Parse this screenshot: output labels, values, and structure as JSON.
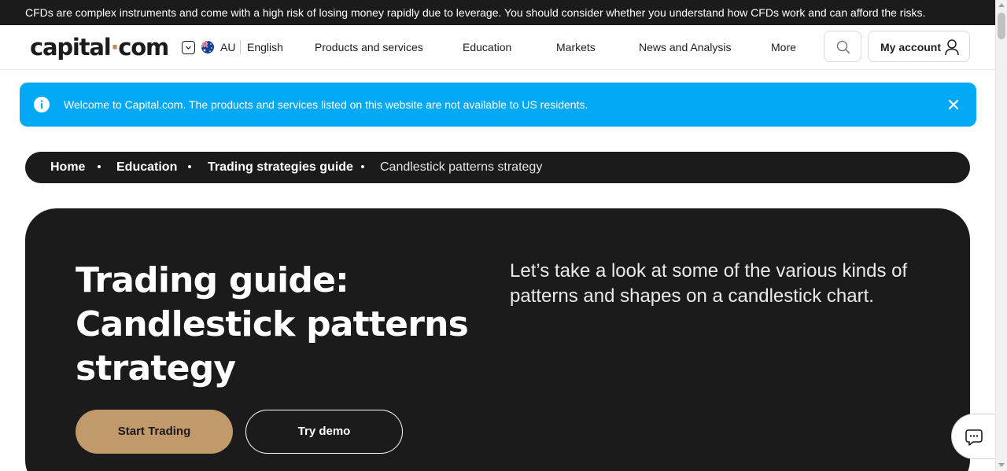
{
  "risk_warning": "CFDs are complex instruments and come with a high risk of losing money rapidly due to leverage. You should consider whether you understand how CFDs work and can afford the risks.",
  "header": {
    "logo_left": "capital",
    "logo_dot": "·",
    "logo_right": "com",
    "country": "AU",
    "language": "English",
    "nav": [
      "Products and services",
      "Education",
      "Markets",
      "News and Analysis",
      "More"
    ],
    "search_icon": "search-icon",
    "account_label": "My account",
    "account_icon": "user-icon"
  },
  "notice": {
    "text": "Welcome to Capital.com. The products and services listed on this website are not available to US residents.",
    "icon": "info-icon",
    "close_icon": "close-icon"
  },
  "breadcrumb": [
    "Home",
    "Education",
    "Trading strategies guide",
    "Candlestick patterns strategy"
  ],
  "hero": {
    "title_lines": [
      "Trading guide:",
      "Candlestick patterns",
      "strategy"
    ],
    "lead": "Let’s take a look at some of the various kinds of patterns and shapes on a candlestick chart.",
    "start_label": "Start Trading",
    "demo_label": "Try demo"
  },
  "chat_icon": "chat-icon",
  "colors": {
    "dark": "#1c1b1c",
    "accent": "#c2996b",
    "notice_blue": "#03a9f4",
    "logo_dot": "#c08b5c"
  }
}
